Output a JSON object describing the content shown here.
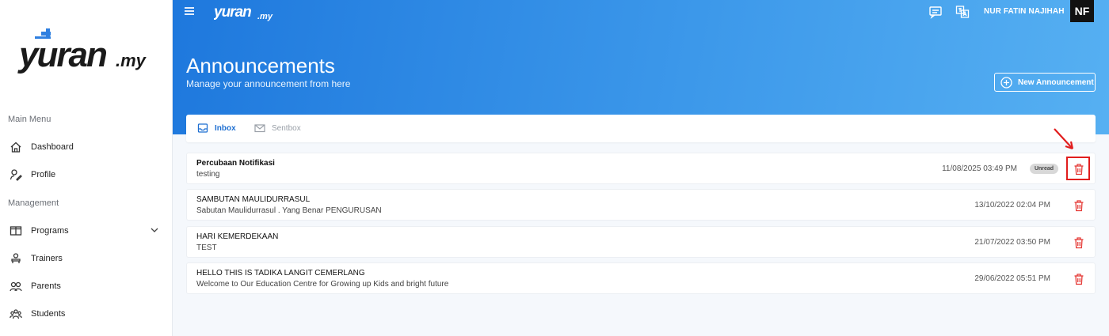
{
  "brand": {
    "name": "Yuran.my"
  },
  "sidebar": {
    "sections": [
      {
        "label": "Main Menu"
      },
      {
        "label": "Management"
      }
    ],
    "items": [
      {
        "label": "Dashboard",
        "icon": "home-icon"
      },
      {
        "label": "Profile",
        "icon": "user-edit-icon"
      },
      {
        "label": "Programs",
        "icon": "book-open-icon"
      },
      {
        "label": "Trainers",
        "icon": "trainer-icon"
      },
      {
        "label": "Parents",
        "icon": "users-icon"
      },
      {
        "label": "Students",
        "icon": "students-icon"
      }
    ]
  },
  "topbar": {
    "user_name": "NUR FATIN NAJIHAH",
    "avatar_initials": "NF",
    "icons": [
      "message-icon",
      "translate-icon"
    ]
  },
  "header": {
    "title": "Announcements",
    "subtitle": "Manage your announcement from here",
    "new_button": "New Announcement"
  },
  "tabs": [
    {
      "label": "Inbox",
      "active": true
    },
    {
      "label": "Sentbox",
      "active": false
    }
  ],
  "announcements": [
    {
      "title": "Percubaan Notifikasi",
      "body": "testing",
      "date": "11/08/2025 03:49 PM",
      "badge": "Unread"
    },
    {
      "title": "SAMBUTAN MAULIDURRASUL",
      "body": "Sabutan Maulidurrasul . Yang Benar PENGURUSAN",
      "date": "13/10/2022 02:04 PM"
    },
    {
      "title": "HARI KEMERDEKAAN",
      "body": "TEST",
      "date": "21/07/2022 03:50 PM"
    },
    {
      "title": "HELLO THIS IS TADIKA LANGIT CEMERLANG",
      "body": "Welcome to Our Education Centre for Growing up Kids and bright future",
      "date": "29/06/2022 05:51 PM"
    }
  ],
  "colors": {
    "accent": "#1e78dd",
    "delete": "#e53935",
    "annotation": "#e11d1d"
  }
}
